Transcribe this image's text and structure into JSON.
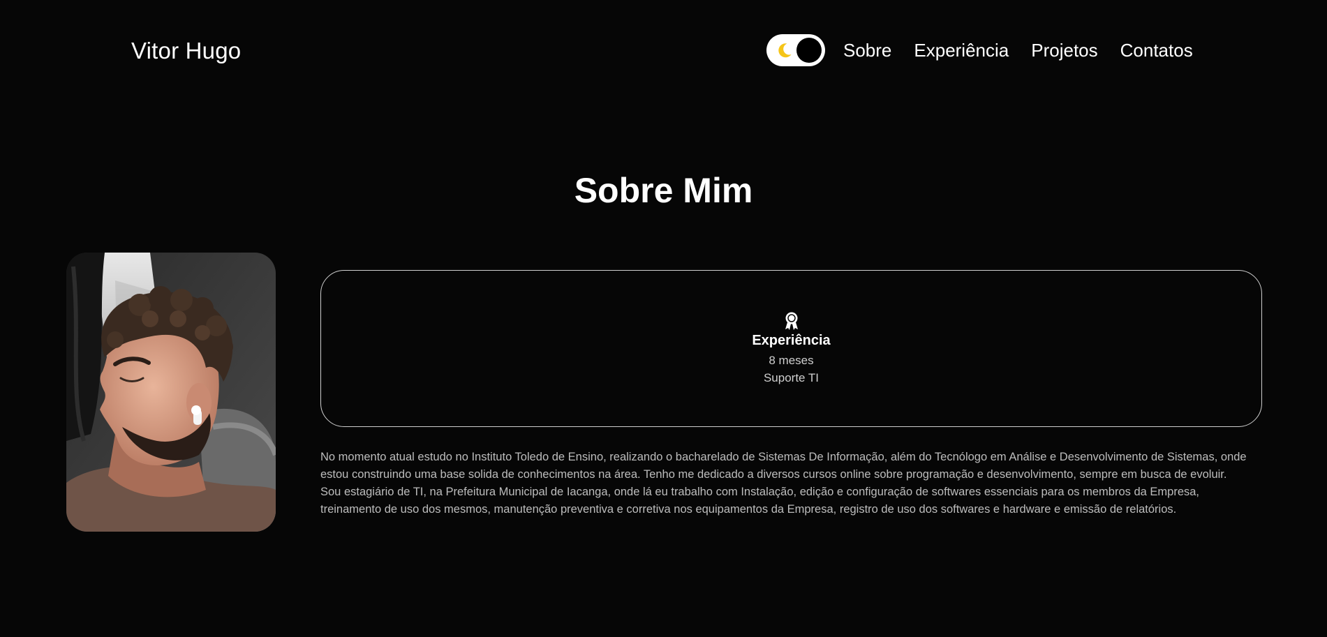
{
  "header": {
    "logo": "Vitor Hugo",
    "theme_toggle": {
      "icon": "moon-icon",
      "accent": "#f5c518",
      "state": "dark"
    },
    "nav": [
      "Sobre",
      "Experiência",
      "Projetos",
      "Contatos"
    ]
  },
  "about": {
    "title": "Sobre Mim",
    "photo_alt": "Foto de perfil",
    "card": {
      "icon": "award-icon",
      "title": "Experiência",
      "duration": "8 meses",
      "role": "Suporte TI"
    },
    "description": "No momento atual estudo no Instituto Toledo de Ensino, realizando o bacharelado de Sistemas De Informação, além do Tecnólogo em Análise e Desenvolvimento de Sistemas, onde estou construindo uma base solida de conhecimentos na área. Tenho me dedicado a diversos cursos online sobre programação e desenvolvimento, sempre em busca de evoluir. Sou estagiário de TI, na Prefeitura Municipal de Iacanga, onde lá eu trabalho com Instalação, edição e configuração de softwares essenciais para os membros da Empresa, treinamento de uso dos mesmos, manutenção preventiva e corretiva nos equipamentos da Empresa, registro de uso dos softwares e hardware e emissão de relatórios."
  }
}
